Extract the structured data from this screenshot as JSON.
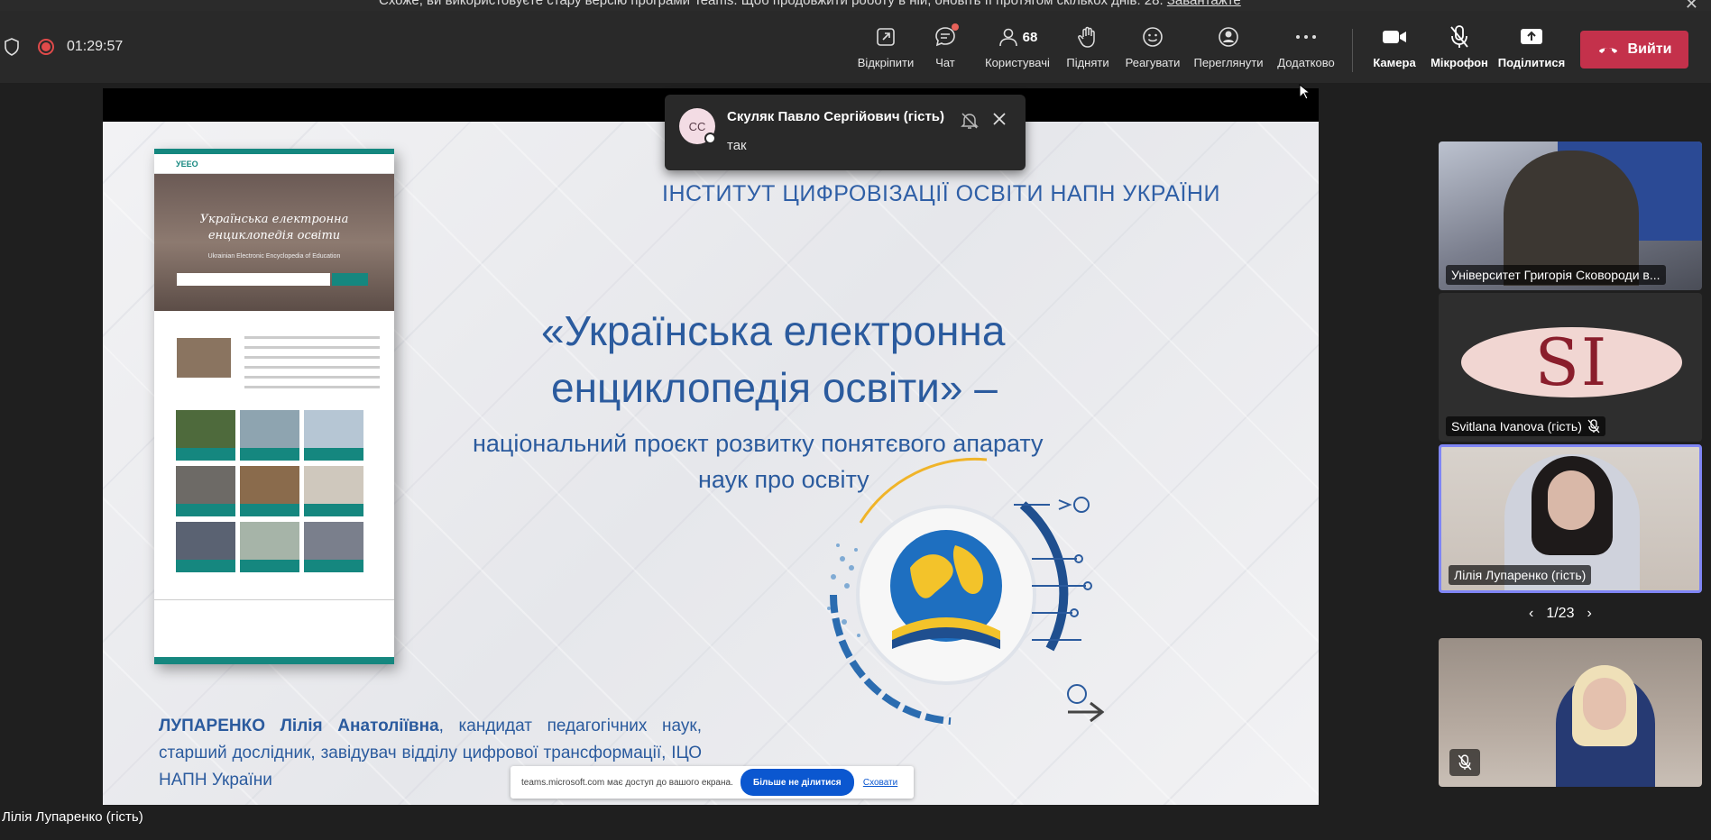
{
  "banner": {
    "text": "Схоже, ви використовуєте стару версію програми Teams. Щоб продовжити роботу в ній, оновіть її протягом скількох днів: 28.",
    "link": "Завантажте"
  },
  "toolbar": {
    "timer": "01:29:57",
    "buttons": {
      "popout": "Відкріпити",
      "chat": "Чат",
      "people": "Користувачі",
      "people_count": "68",
      "raise": "Підняти",
      "react": "Реагувати",
      "view": "Переглянути",
      "more": "Додатково",
      "camera": "Камера",
      "mic": "Мікрофон",
      "share": "Поділитися",
      "leave": "Вийти"
    }
  },
  "toast": {
    "initials": "CC",
    "name": "Скуляк Павло Сергійович (гість)",
    "message": "так"
  },
  "slide": {
    "institute": "ІНСТИТУТ ЦИФРОВІЗАЦІЇ ОСВІТИ НАПН УКРАЇНИ",
    "title_line1": "«Українська електронна",
    "title_line2": "енциклопедія освіти» –",
    "subtitle_line1": "національний проєкт розвитку понятєвого апарату",
    "subtitle_line2": "наук про освіту",
    "author_name": "ЛУПАРЕНКО Лілія Анатоліївна",
    "author_desc": ", кандидат педагогічних наук, старший дослідник, завідувач відділу цифрової трансформації, ІЦО НАПН України",
    "site_hero_line1": "Українська електронна",
    "site_hero_line2": "енциклопедія освіти",
    "site_hero_en": "Ukrainian Electronic Encyclopedia of Education"
  },
  "sharebar": {
    "text": "teams.microsoft.com має доступ до вашого екрана.",
    "stop": "Більше не ділитися",
    "hide": "Сховати"
  },
  "presenter": "Лілія Лупаренко (гість)",
  "gallery": {
    "tile1": "Університет Григорія Сковороди в...",
    "tile2_initials": "SI",
    "tile2": "Svitlana Ivanova (гість)",
    "tile3": "Лілія Лупаренко (гість)",
    "pager": "1/23"
  },
  "colors": {
    "leave": "#c4314b",
    "slide_text": "#2b5b9e",
    "accent": "#7f85f5",
    "site_teal": "#15877f"
  }
}
